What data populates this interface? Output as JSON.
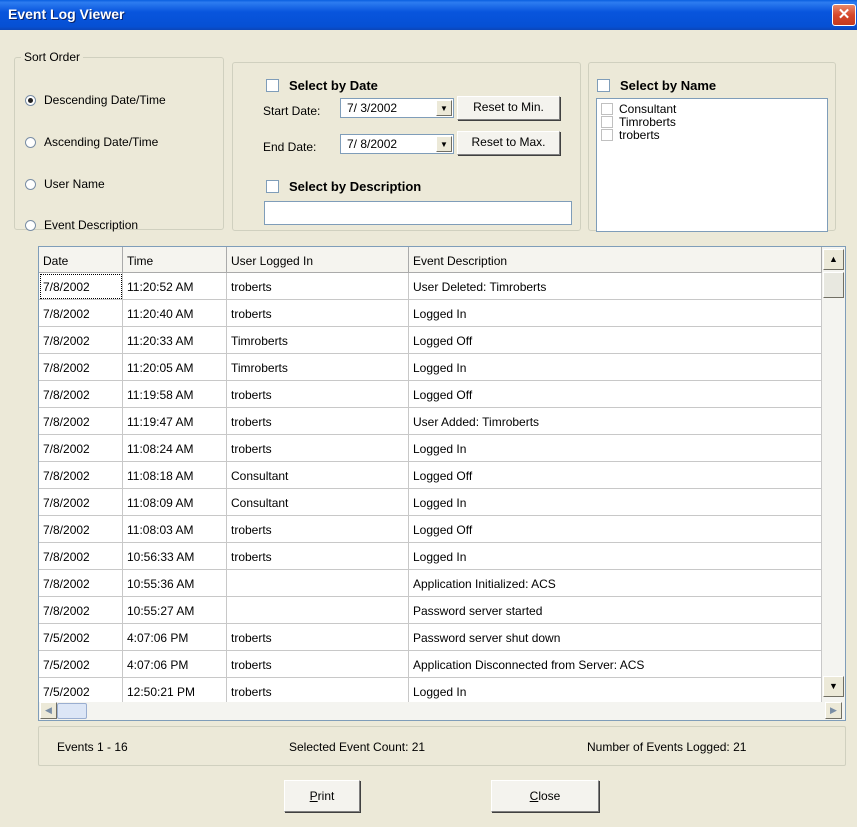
{
  "window": {
    "title": "Event Log Viewer",
    "close_glyph": "✕"
  },
  "sort_order": {
    "legend": "Sort Order",
    "options": [
      {
        "label": "Descending Date/Time",
        "checked": true
      },
      {
        "label": "Ascending Date/Time",
        "checked": false
      },
      {
        "label": "User Name",
        "checked": false
      },
      {
        "label": "Event Description",
        "checked": false
      }
    ]
  },
  "filter_date": {
    "label": "Select by Date",
    "start_label": "Start Date:",
    "start_value": "7/ 3/2002",
    "reset_min_label": "Reset to Min.",
    "end_label": "End Date:",
    "end_value": "7/ 8/2002",
    "reset_max_label": "Reset to  Max."
  },
  "filter_description": {
    "label": "Select by Description",
    "value": ""
  },
  "filter_name": {
    "label": "Select by Name",
    "names": [
      "Consultant",
      "Timroberts",
      "troberts"
    ]
  },
  "grid": {
    "columns": [
      "Date",
      "Time",
      "User Logged In",
      "Event Description"
    ],
    "rows": [
      [
        "7/8/2002",
        "11:20:52 AM",
        "troberts",
        "User Deleted: Timroberts"
      ],
      [
        "7/8/2002",
        "11:20:40 AM",
        "troberts",
        "Logged In"
      ],
      [
        "7/8/2002",
        "11:20:33 AM",
        "Timroberts",
        "Logged Off"
      ],
      [
        "7/8/2002",
        "11:20:05 AM",
        "Timroberts",
        "Logged In"
      ],
      [
        "7/8/2002",
        "11:19:58 AM",
        "troberts",
        "Logged Off"
      ],
      [
        "7/8/2002",
        "11:19:47 AM",
        "troberts",
        "User Added: Timroberts"
      ],
      [
        "7/8/2002",
        "11:08:24 AM",
        "troberts",
        "Logged In"
      ],
      [
        "7/8/2002",
        "11:08:18 AM",
        "Consultant",
        "Logged Off"
      ],
      [
        "7/8/2002",
        "11:08:09 AM",
        "Consultant",
        "Logged In"
      ],
      [
        "7/8/2002",
        "11:08:03 AM",
        "troberts",
        "Logged Off"
      ],
      [
        "7/8/2002",
        "10:56:33 AM",
        "troberts",
        "Logged In"
      ],
      [
        "7/8/2002",
        "10:55:36 AM",
        "",
        "Application Initialized: ACS"
      ],
      [
        "7/8/2002",
        "10:55:27 AM",
        "",
        "Password server started"
      ],
      [
        "7/5/2002",
        "4:07:06 PM",
        "troberts",
        "Password server shut down"
      ],
      [
        "7/5/2002",
        "4:07:06 PM",
        "troberts",
        "Application Disconnected from Server: ACS"
      ],
      [
        "7/5/2002",
        "12:50:21 PM",
        "troberts",
        "Logged In"
      ]
    ]
  },
  "scroll_glyphs": {
    "up": "▲",
    "down": "▼",
    "left": "◀",
    "right": "▶"
  },
  "status": {
    "events_range": "Events 1 - 16",
    "selected_count": "Selected Event Count:  21",
    "logged_count": "Number of Events Logged:  21"
  },
  "buttons": {
    "print": {
      "accel": "P",
      "rest": "rint"
    },
    "close": {
      "accel": "C",
      "rest": "lose"
    }
  },
  "dropdown_glyph": "▼"
}
